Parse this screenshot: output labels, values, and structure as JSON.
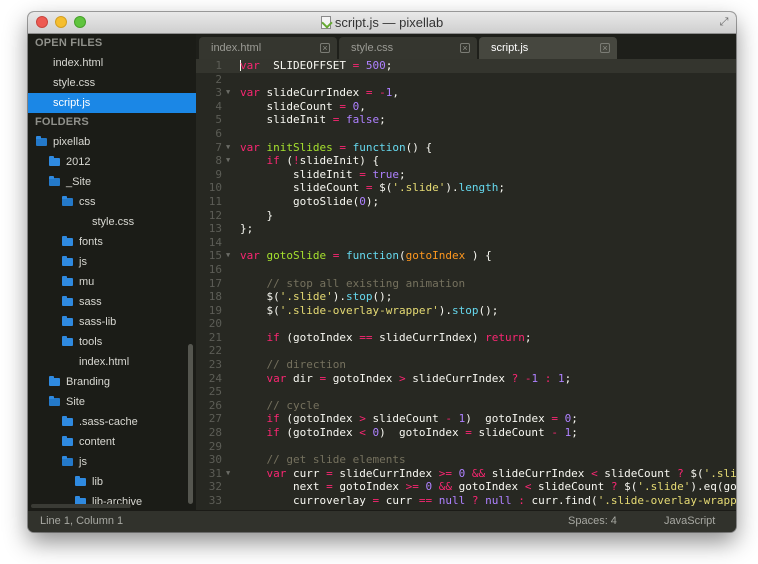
{
  "window": {
    "title": "script.js — pixellab"
  },
  "sidebar": {
    "open_files_heading": "OPEN FILES",
    "open_files": [
      "index.html",
      "style.css",
      "script.js"
    ],
    "folders_heading": "FOLDERS",
    "tree": [
      {
        "label": "pixellab",
        "type": "folder",
        "open": true
      },
      {
        "label": "2012",
        "type": "folder",
        "open": false
      },
      {
        "label": "_Site",
        "type": "folder",
        "open": true
      },
      {
        "label": "css",
        "type": "folder",
        "open": true
      },
      {
        "label": "style.css",
        "type": "file"
      },
      {
        "label": "fonts",
        "type": "folder",
        "open": false
      },
      {
        "label": "js",
        "type": "folder",
        "open": false
      },
      {
        "label": "mu",
        "type": "folder",
        "open": false
      },
      {
        "label": "sass",
        "type": "folder",
        "open": false
      },
      {
        "label": "sass-lib",
        "type": "folder",
        "open": false
      },
      {
        "label": "tools",
        "type": "folder",
        "open": false
      },
      {
        "label": "index.html",
        "type": "file"
      },
      {
        "label": "Branding",
        "type": "folder",
        "open": false
      },
      {
        "label": "Site",
        "type": "folder",
        "open": true
      },
      {
        "label": ".sass-cache",
        "type": "folder",
        "open": false
      },
      {
        "label": "content",
        "type": "folder",
        "open": false
      },
      {
        "label": "js",
        "type": "folder",
        "open": true
      },
      {
        "label": "lib",
        "type": "folder",
        "open": false
      },
      {
        "label": "lib-archive",
        "type": "folder",
        "open": false
      }
    ]
  },
  "tabs": [
    {
      "label": "index.html",
      "close": "×"
    },
    {
      "label": "style.css",
      "close": "×"
    },
    {
      "label": "script.js",
      "close": "×"
    }
  ],
  "editor": {
    "lines": [
      {
        "n": "1",
        "fold": "",
        "t": [
          [
            "k",
            "var"
          ],
          [
            "",
            "  SLIDEOFFSET "
          ],
          [
            "k",
            "="
          ],
          [
            "",
            " "
          ],
          [
            "n",
            "500"
          ],
          [
            "",
            ";"
          ]
        ]
      },
      {
        "n": "2",
        "fold": "",
        "t": []
      },
      {
        "n": "3",
        "fold": "▼",
        "t": [
          [
            "k",
            "var"
          ],
          [
            "",
            " slideCurrIndex "
          ],
          [
            "k",
            "="
          ],
          [
            "",
            " "
          ],
          [
            "k",
            "-"
          ],
          [
            "n",
            "1"
          ],
          [
            "",
            ","
          ]
        ]
      },
      {
        "n": "4",
        "fold": "",
        "t": [
          [
            "",
            "    slideCount "
          ],
          [
            "k",
            "="
          ],
          [
            "",
            " "
          ],
          [
            "n",
            "0"
          ],
          [
            "",
            ","
          ]
        ]
      },
      {
        "n": "5",
        "fold": "",
        "t": [
          [
            "",
            "    slideInit "
          ],
          [
            "k",
            "="
          ],
          [
            "",
            " "
          ],
          [
            "n",
            "false"
          ],
          [
            "",
            ";"
          ]
        ]
      },
      {
        "n": "6",
        "fold": "",
        "t": []
      },
      {
        "n": "7",
        "fold": "▼",
        "t": [
          [
            "k",
            "var"
          ],
          [
            "",
            " "
          ],
          [
            "f",
            "initSlides"
          ],
          [
            "",
            " "
          ],
          [
            "k",
            "="
          ],
          [
            "",
            " "
          ],
          [
            "b",
            "function"
          ],
          [
            "",
            "() {"
          ]
        ]
      },
      {
        "n": "8",
        "fold": "▼",
        "t": [
          [
            "",
            "    "
          ],
          [
            "k",
            "if"
          ],
          [
            "",
            " ("
          ],
          [
            "k",
            "!"
          ],
          [
            "",
            "slideInit) {"
          ]
        ]
      },
      {
        "n": "9",
        "fold": "",
        "t": [
          [
            "",
            "        slideInit "
          ],
          [
            "k",
            "="
          ],
          [
            "",
            " "
          ],
          [
            "n",
            "true"
          ],
          [
            "",
            ";"
          ]
        ]
      },
      {
        "n": "10",
        "fold": "",
        "t": [
          [
            "",
            "        slideCount "
          ],
          [
            "k",
            "="
          ],
          [
            "",
            " $("
          ],
          [
            "s",
            "'.slide'"
          ],
          [
            "",
            ")."
          ],
          [
            "b",
            "length"
          ],
          [
            "",
            ";"
          ]
        ]
      },
      {
        "n": "11",
        "fold": "",
        "t": [
          [
            "",
            "        gotoSlide("
          ],
          [
            "n",
            "0"
          ],
          [
            "",
            ");"
          ]
        ]
      },
      {
        "n": "12",
        "fold": "",
        "t": [
          [
            "",
            "    }"
          ]
        ]
      },
      {
        "n": "13",
        "fold": "",
        "t": [
          [
            "",
            "};"
          ]
        ]
      },
      {
        "n": "14",
        "fold": "",
        "t": []
      },
      {
        "n": "15",
        "fold": "▼",
        "t": [
          [
            "k",
            "var"
          ],
          [
            "",
            " "
          ],
          [
            "f",
            "gotoSlide"
          ],
          [
            "",
            " "
          ],
          [
            "k",
            "="
          ],
          [
            "",
            " "
          ],
          [
            "b",
            "function"
          ],
          [
            "",
            "("
          ],
          [
            "p",
            "gotoIndex"
          ],
          [
            "",
            " ) {"
          ]
        ]
      },
      {
        "n": "16",
        "fold": "",
        "t": []
      },
      {
        "n": "17",
        "fold": "",
        "t": [
          [
            "",
            "    "
          ],
          [
            "c",
            "// stop all existing animation"
          ]
        ]
      },
      {
        "n": "18",
        "fold": "",
        "t": [
          [
            "",
            "    $("
          ],
          [
            "s",
            "'.slide'"
          ],
          [
            "",
            ")."
          ],
          [
            "b",
            "stop"
          ],
          [
            "",
            "();"
          ]
        ]
      },
      {
        "n": "19",
        "fold": "",
        "t": [
          [
            "",
            "    $("
          ],
          [
            "s",
            "'.slide-overlay-wrapper'"
          ],
          [
            "",
            ")."
          ],
          [
            "b",
            "stop"
          ],
          [
            "",
            "();"
          ]
        ]
      },
      {
        "n": "20",
        "fold": "",
        "t": []
      },
      {
        "n": "21",
        "fold": "",
        "t": [
          [
            "",
            "    "
          ],
          [
            "k",
            "if"
          ],
          [
            "",
            " (gotoIndex "
          ],
          [
            "k",
            "=="
          ],
          [
            "",
            " slideCurrIndex) "
          ],
          [
            "k",
            "return"
          ],
          [
            "",
            ";"
          ]
        ]
      },
      {
        "n": "22",
        "fold": "",
        "t": []
      },
      {
        "n": "23",
        "fold": "",
        "t": [
          [
            "",
            "    "
          ],
          [
            "c",
            "// direction"
          ]
        ]
      },
      {
        "n": "24",
        "fold": "",
        "t": [
          [
            "",
            "    "
          ],
          [
            "k",
            "var"
          ],
          [
            "",
            " dir "
          ],
          [
            "k",
            "="
          ],
          [
            "",
            " gotoIndex "
          ],
          [
            "k",
            ">"
          ],
          [
            "",
            " slideCurrIndex "
          ],
          [
            "k",
            "?"
          ],
          [
            "",
            " "
          ],
          [
            "k",
            "-"
          ],
          [
            "n",
            "1"
          ],
          [
            "",
            " "
          ],
          [
            "k",
            ":"
          ],
          [
            "",
            " "
          ],
          [
            "n",
            "1"
          ],
          [
            "",
            ";"
          ]
        ]
      },
      {
        "n": "25",
        "fold": "",
        "t": []
      },
      {
        "n": "26",
        "fold": "",
        "t": [
          [
            "",
            "    "
          ],
          [
            "c",
            "// cycle"
          ]
        ]
      },
      {
        "n": "27",
        "fold": "",
        "t": [
          [
            "",
            "    "
          ],
          [
            "k",
            "if"
          ],
          [
            "",
            " (gotoIndex "
          ],
          [
            "k",
            ">"
          ],
          [
            "",
            " slideCount "
          ],
          [
            "k",
            "-"
          ],
          [
            "",
            " "
          ],
          [
            "n",
            "1"
          ],
          [
            "",
            ")  gotoIndex "
          ],
          [
            "k",
            "="
          ],
          [
            "",
            " "
          ],
          [
            "n",
            "0"
          ],
          [
            "",
            ";"
          ]
        ]
      },
      {
        "n": "28",
        "fold": "",
        "t": [
          [
            "",
            "    "
          ],
          [
            "k",
            "if"
          ],
          [
            "",
            " (gotoIndex "
          ],
          [
            "k",
            "<"
          ],
          [
            "",
            " "
          ],
          [
            "n",
            "0"
          ],
          [
            "",
            ")  gotoIndex "
          ],
          [
            "k",
            "="
          ],
          [
            "",
            " slideCount "
          ],
          [
            "k",
            "-"
          ],
          [
            "",
            " "
          ],
          [
            "n",
            "1"
          ],
          [
            "",
            ";"
          ]
        ]
      },
      {
        "n": "29",
        "fold": "",
        "t": []
      },
      {
        "n": "30",
        "fold": "",
        "t": [
          [
            "",
            "    "
          ],
          [
            "c",
            "// get slide elements"
          ]
        ]
      },
      {
        "n": "31",
        "fold": "▼",
        "t": [
          [
            "",
            "    "
          ],
          [
            "k",
            "var"
          ],
          [
            "",
            " curr "
          ],
          [
            "k",
            "="
          ],
          [
            "",
            " slideCurrIndex "
          ],
          [
            "k",
            ">="
          ],
          [
            "",
            " "
          ],
          [
            "n",
            "0"
          ],
          [
            "",
            " "
          ],
          [
            "k",
            "&&"
          ],
          [
            "",
            " slideCurrIndex "
          ],
          [
            "k",
            "<"
          ],
          [
            "",
            " slideCount "
          ],
          [
            "k",
            "?"
          ],
          [
            "",
            " $("
          ],
          [
            "s",
            "'.slide'"
          ]
        ]
      },
      {
        "n": "32",
        "fold": "",
        "t": [
          [
            "",
            "        next "
          ],
          [
            "k",
            "="
          ],
          [
            "",
            " gotoIndex "
          ],
          [
            "k",
            ">="
          ],
          [
            "",
            " "
          ],
          [
            "n",
            "0"
          ],
          [
            "",
            " "
          ],
          [
            "k",
            "&&"
          ],
          [
            "",
            " gotoIndex "
          ],
          [
            "k",
            "<"
          ],
          [
            "",
            " slideCount "
          ],
          [
            "k",
            "?"
          ],
          [
            "",
            " $("
          ],
          [
            "s",
            "'.slide'"
          ],
          [
            "",
            ").eq(gotoI"
          ]
        ]
      },
      {
        "n": "33",
        "fold": "",
        "t": [
          [
            "",
            "        curroverlay "
          ],
          [
            "k",
            "="
          ],
          [
            "",
            " curr "
          ],
          [
            "k",
            "=="
          ],
          [
            "",
            " "
          ],
          [
            "n",
            "null"
          ],
          [
            "",
            " "
          ],
          [
            "k",
            "?"
          ],
          [
            "",
            " "
          ],
          [
            "n",
            "null"
          ],
          [
            "",
            " "
          ],
          [
            "k",
            ":"
          ],
          [
            "",
            " curr.find("
          ],
          [
            "s",
            "'.slide-overlay-wrapper'"
          ]
        ]
      }
    ]
  },
  "status": {
    "position": "Line 1, Column 1",
    "spaces": "Spaces: 4",
    "syntax": "JavaScript"
  },
  "colors": {
    "sidebar_selection": "#1b87e6",
    "editor_bg": "#272822",
    "keyword": "#f92672",
    "string": "#e6db74",
    "number": "#ae81ff",
    "function": "#a6e22e",
    "param": "#fd971f",
    "comment": "#75715e"
  }
}
